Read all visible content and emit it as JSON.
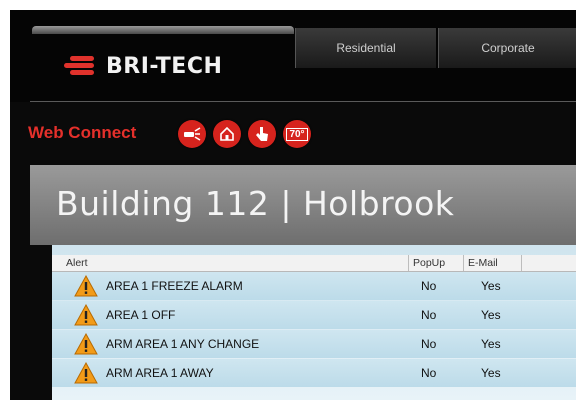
{
  "brand": {
    "name": "BRI-TECH",
    "accent": "#e0322c"
  },
  "nav": {
    "tabs": [
      "Residential",
      "Corporate"
    ]
  },
  "web_connect": {
    "label": "Web Connect",
    "icons": [
      {
        "name": "alarm-icon",
        "text": ""
      },
      {
        "name": "home-icon",
        "text": ""
      },
      {
        "name": "touch-icon",
        "text": ""
      },
      {
        "name": "thermostat-icon",
        "text": "70°"
      }
    ]
  },
  "building": {
    "title": "Building 112 | Holbrook"
  },
  "alerts": {
    "columns": [
      "Alert",
      "PopUp",
      "E-Mail"
    ],
    "rows": [
      {
        "name": "AREA 1 FREEZE ALARM",
        "popup": "No",
        "email": "Yes"
      },
      {
        "name": "AREA 1 OFF",
        "popup": "No",
        "email": "Yes"
      },
      {
        "name": "ARM AREA 1 ANY CHANGE",
        "popup": "No",
        "email": "Yes"
      },
      {
        "name": "ARM AREA 1 AWAY",
        "popup": "No",
        "email": "Yes"
      }
    ]
  }
}
